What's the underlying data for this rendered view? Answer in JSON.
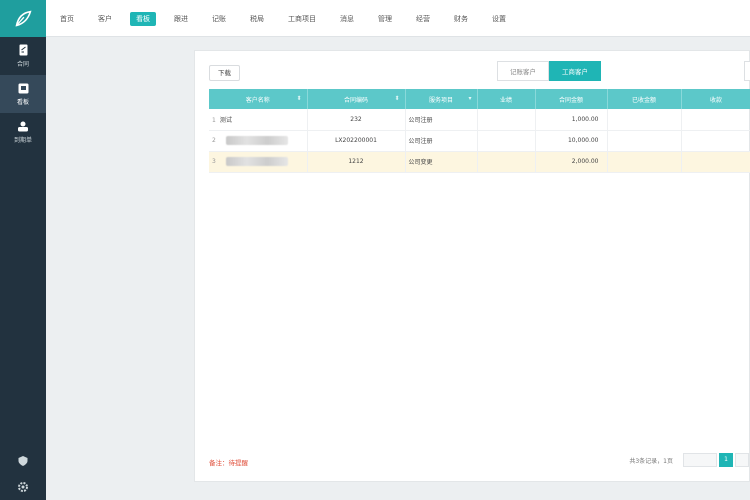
{
  "nav": {
    "items": [
      {
        "label": "首页",
        "active": false
      },
      {
        "label": "客户",
        "active": false
      },
      {
        "label": "看板",
        "active": true
      },
      {
        "label": "跟进",
        "active": false
      },
      {
        "label": "记账",
        "active": false
      },
      {
        "label": "税局",
        "active": false
      },
      {
        "label": "工商项目",
        "active": false
      },
      {
        "label": "消息",
        "active": false
      },
      {
        "label": "管理",
        "active": false
      },
      {
        "label": "经营",
        "active": false
      },
      {
        "label": "财务",
        "active": false
      },
      {
        "label": "设置",
        "active": false
      }
    ]
  },
  "sidebar": {
    "items": [
      {
        "label": "合同",
        "icon": "document-icon",
        "active": false
      },
      {
        "label": "看板",
        "icon": "board-icon",
        "active": true
      },
      {
        "label": "到期单",
        "icon": "user-card-icon",
        "active": false
      }
    ]
  },
  "toolbar": {
    "download_label": "下载"
  },
  "tabs": [
    {
      "label": "记账客户",
      "active": false
    },
    {
      "label": "工商客户",
      "active": true
    }
  ],
  "table": {
    "columns": [
      "客户名称",
      "合同编码",
      "服务项目",
      "业绩",
      "合同金额",
      "已收金额",
      "收款"
    ],
    "rows": [
      {
        "index": "1",
        "name": "测试",
        "code": "232",
        "service": "公司注册",
        "amount": "1,000.00",
        "blurred": false,
        "highlight": false
      },
      {
        "index": "2",
        "name": "",
        "code": "LX202200001",
        "service": "公司注册",
        "amount": "10,000.00",
        "blurred": true,
        "highlight": false
      },
      {
        "index": "3",
        "name": "",
        "code": "1212",
        "service": "公司变更",
        "amount": "2,000.00",
        "blurred": true,
        "highlight": true
      }
    ]
  },
  "footer": {
    "note": "备注：待提醒",
    "total": "共3条记录，1页",
    "current_page": "1"
  },
  "colors": {
    "accent": "#1fb5b5",
    "sidebar": "#22323f",
    "header": "#5cc8c9",
    "highlight_row": "#fdf6e0",
    "note": "#e0503c"
  }
}
